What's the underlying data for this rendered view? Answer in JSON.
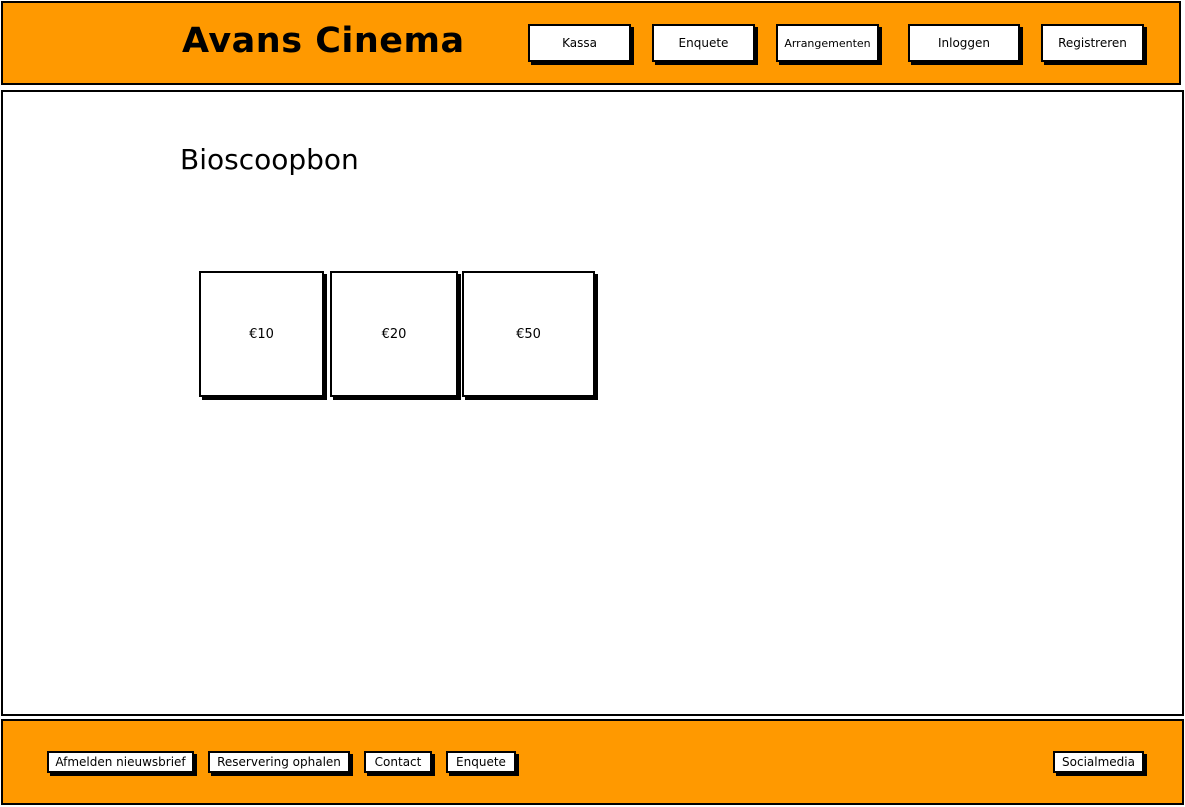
{
  "header": {
    "logo": "Avans Cinema",
    "nav": {
      "kassa": "Kassa",
      "enquete": "Enquete",
      "arrangementen": "Arrangementen",
      "inloggen": "Inloggen",
      "registreren": "Registreren"
    }
  },
  "main": {
    "title": "Bioscoopbon",
    "vouchers": {
      "v10": "€10",
      "v20": "€20",
      "v50": "€50"
    }
  },
  "footer": {
    "links": {
      "afmelden": "Afmelden nieuwsbrief",
      "reservering": "Reservering ophalen",
      "contact": "Contact",
      "enquete": "Enquete",
      "socialmedia": "Socialmedia"
    }
  },
  "colors": {
    "brand_orange": "#ff9900",
    "border": "#000000",
    "background": "#ffffff"
  }
}
